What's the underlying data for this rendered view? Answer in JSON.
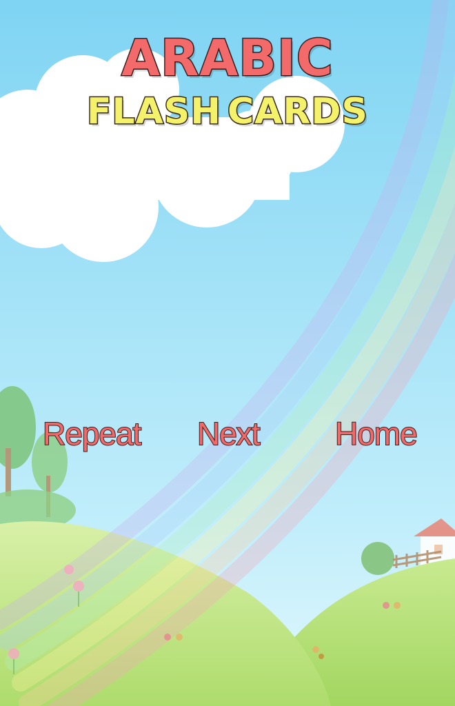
{
  "title": {
    "line1": "ARABIC",
    "line2": "FLASH CARDS"
  },
  "buttons": {
    "repeat": "Repeat",
    "next": "Next",
    "home": "Home"
  },
  "colors": {
    "sky_top": "#7fd4f3",
    "sky_bottom": "#c7f0fb",
    "title_red": "#f26a6a",
    "title_yellow": "#f4f26a",
    "grass": "#b5e07a"
  }
}
